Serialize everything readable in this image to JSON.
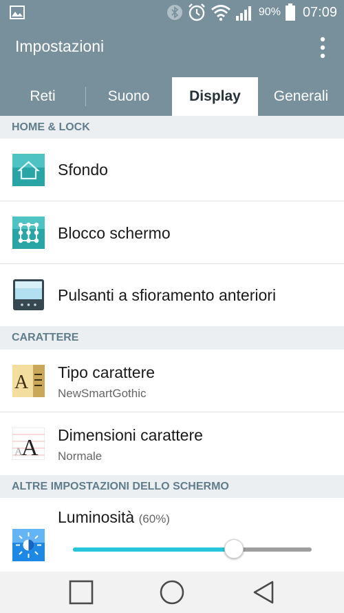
{
  "status_bar": {
    "battery_percent": "90%",
    "time": "07:09",
    "icons": [
      "image-icon",
      "bluetooth-icon",
      "alarm-icon",
      "wifi-icon",
      "signal-icon",
      "battery-icon"
    ]
  },
  "app_bar": {
    "title": "Impostazioni",
    "menu_icon": "overflow-menu-icon"
  },
  "tabs": [
    {
      "label": "Reti",
      "active": false
    },
    {
      "label": "Suono",
      "active": false
    },
    {
      "label": "Display",
      "active": true
    },
    {
      "label": "Generali",
      "active": false
    }
  ],
  "sections": {
    "home_lock": {
      "header": "HOME & LOCK",
      "items": [
        {
          "title": "Sfondo",
          "icon": "home-wallpaper-icon"
        },
        {
          "title": "Blocco schermo",
          "icon": "pattern-lock-icon"
        },
        {
          "title": "Pulsanti a sfioramento anteriori",
          "icon": "touch-buttons-icon"
        }
      ]
    },
    "carattere": {
      "header": "CARATTERE",
      "items": [
        {
          "title": "Tipo carattere",
          "subtitle": "NewSmartGothic",
          "icon": "font-type-icon"
        },
        {
          "title": "Dimensioni carattere",
          "subtitle": "Normale",
          "icon": "font-size-icon"
        }
      ]
    },
    "altre": {
      "header": "ALTRE IMPOSTAZIONI DELLO SCHERMO",
      "brightness": {
        "title": "Luminosità",
        "percent_label": "(60%)",
        "value_fraction": 0.6,
        "icon": "brightness-icon"
      }
    }
  },
  "colors": {
    "header_bg": "#78909c",
    "accent": "#26c6da",
    "section_bg": "#eceff1",
    "section_text": "#607d8b"
  },
  "nav_bar": {
    "buttons": [
      "recents-button",
      "home-button",
      "back-button"
    ]
  }
}
